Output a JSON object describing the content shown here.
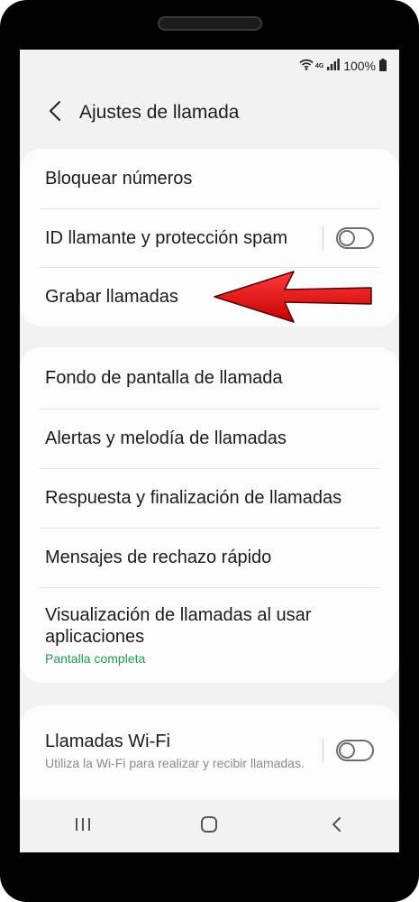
{
  "status_bar": {
    "network": "4G",
    "battery_text": "100%"
  },
  "header": {
    "title": "Ajustes de llamada"
  },
  "card1": {
    "items": [
      {
        "label": "Bloquear números"
      },
      {
        "label": "ID llamante y protección spam",
        "toggle": false
      },
      {
        "label": "Grabar llamadas"
      }
    ]
  },
  "card2": {
    "items": [
      {
        "label": "Fondo de pantalla de llamada"
      },
      {
        "label": "Alertas y melodía de llamadas"
      },
      {
        "label": "Respuesta y finalización de llamadas"
      },
      {
        "label": "Mensajes de rechazo rápido"
      },
      {
        "label": "Visualización de llamadas al usar aplicaciones",
        "sub": "Pantalla completa"
      }
    ]
  },
  "card3": {
    "items": [
      {
        "label": "Llamadas Wi-Fi",
        "sub": "Utiliza la Wi-Fi para realizar y recibir llamadas.",
        "toggle": false
      }
    ]
  },
  "colors": {
    "accent_green": "#1f9d55",
    "arrow_red": "#e00000"
  },
  "icons": {
    "back": "chevron-left-icon",
    "wifi": "wifi-icon",
    "signal": "signal-icon",
    "battery": "battery-icon",
    "recents": "recents-icon",
    "home": "home-icon",
    "nav_back": "nav-back-icon"
  }
}
